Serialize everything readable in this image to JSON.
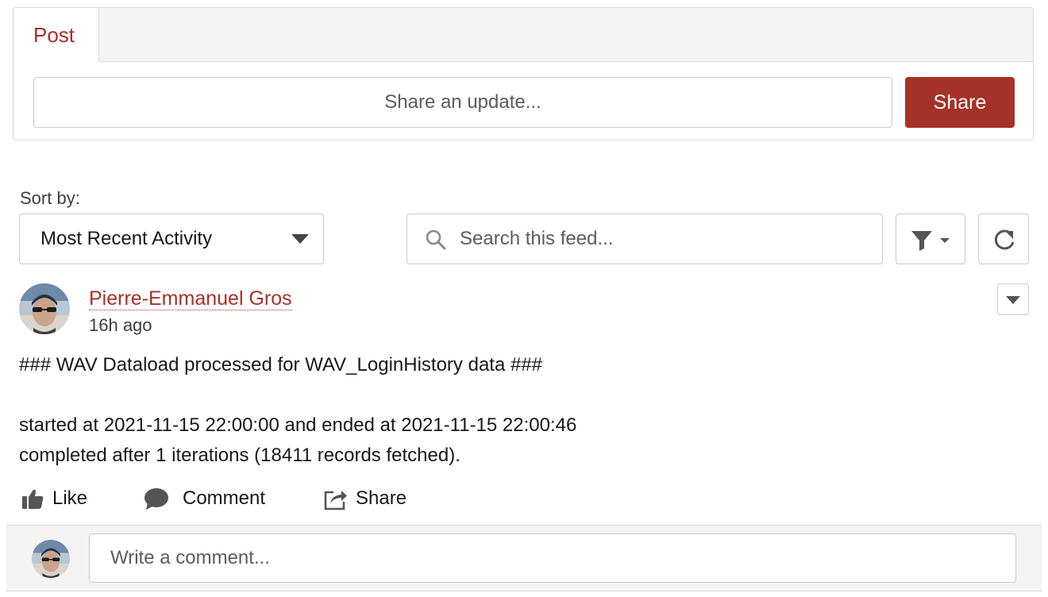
{
  "publisher": {
    "tab_label": "Post",
    "input_placeholder": "Share an update...",
    "share_button": "Share"
  },
  "feed_controls": {
    "sort_label": "Sort by:",
    "sort_value": "Most Recent Activity",
    "search_placeholder": "Search this feed..."
  },
  "post": {
    "author": "Pierre-Emmanuel Gros",
    "timestamp": "16h ago",
    "body": [
      "### WAV Dataload processed for WAV_LoginHistory data ###",
      "started at 2021-11-15 22:00:00 and ended at 2021-11-15 22:00:46",
      "completed after 1 iterations (18411 records fetched)."
    ],
    "actions": {
      "like": "Like",
      "comment": "Comment",
      "share": "Share"
    }
  },
  "comment_box": {
    "placeholder": "Write a comment..."
  },
  "colors": {
    "brand": "#a63128",
    "border": "#c9c9c9",
    "panel_bg": "#f3f3f3"
  }
}
